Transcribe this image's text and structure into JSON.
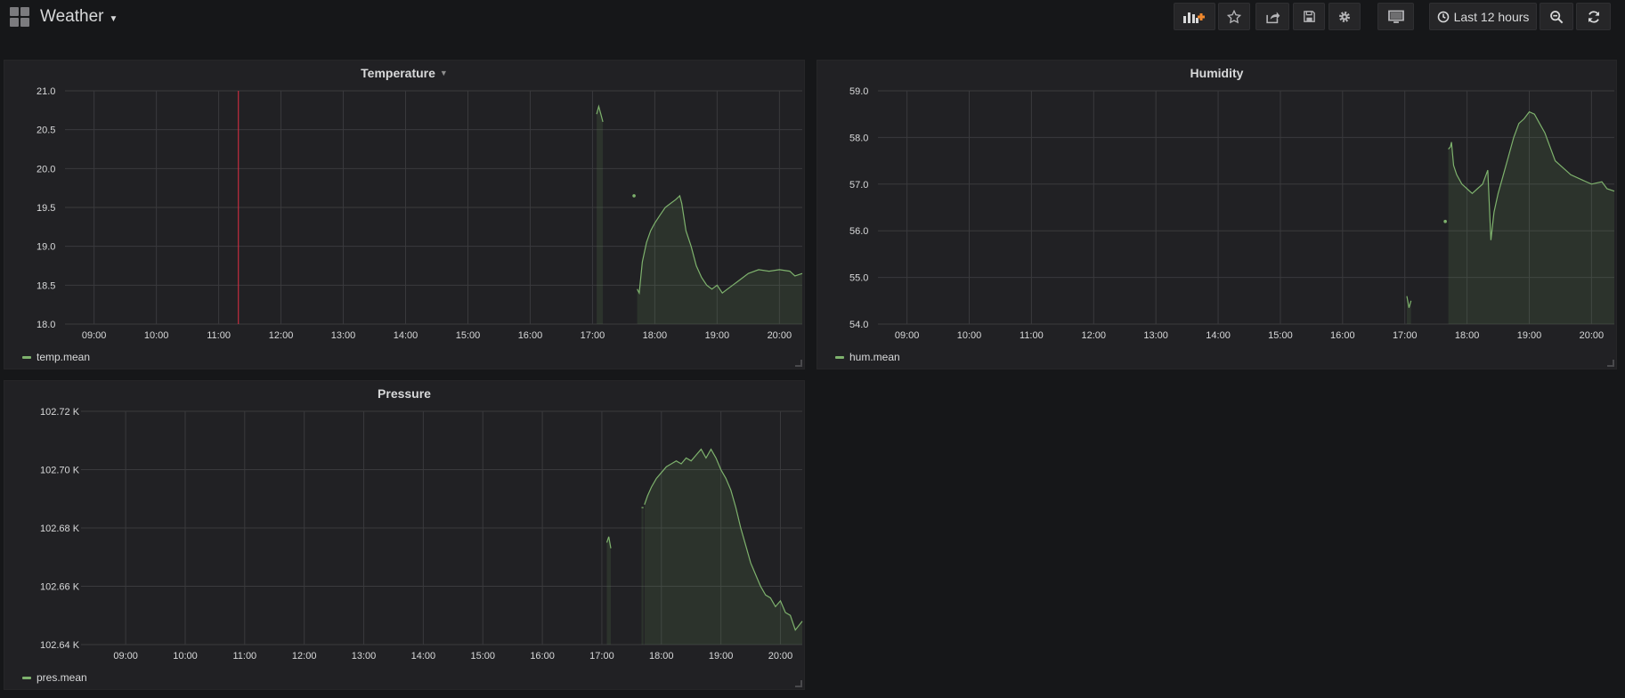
{
  "header": {
    "dashboard_title": "Weather",
    "time_range_label": "Last 12 hours"
  },
  "icons": {
    "add_panel": "add-panel-icon",
    "star": "star-icon",
    "share": "share-icon",
    "save": "save-icon",
    "settings": "gear-icon",
    "tv_mode": "monitor-icon",
    "clock": "clock-icon",
    "zoom_out": "zoom-out-icon",
    "refresh": "refresh-icon"
  },
  "colors": {
    "series": "#7eb26d",
    "annotation": "#e02f44",
    "background": "#161719",
    "panel": "#212124",
    "grid": "#3a3a3d"
  },
  "panels": [
    {
      "title": "Temperature",
      "legend": "temp.mean"
    },
    {
      "title": "Humidity",
      "legend": "hum.mean"
    },
    {
      "title": "Pressure",
      "legend": "pres.mean"
    }
  ],
  "chart_data": [
    {
      "type": "area",
      "title": "Temperature",
      "x_ticks": [
        "09:00",
        "10:00",
        "11:00",
        "12:00",
        "13:00",
        "14:00",
        "15:00",
        "16:00",
        "17:00",
        "18:00",
        "19:00",
        "20:00"
      ],
      "x_range": [
        "08:32",
        "20:22"
      ],
      "y_ticks": [
        "18.0",
        "18.5",
        "19.0",
        "19.5",
        "20.0",
        "20.5",
        "21.0"
      ],
      "ylim": [
        18.0,
        21.0
      ],
      "grid": true,
      "annotation_x": "11:19",
      "series": [
        {
          "name": "temp.mean",
          "segments": [
            [
              [
                "17:04",
                20.7
              ],
              [
                "17:06",
                20.8
              ],
              [
                "17:08",
                20.7
              ],
              [
                "17:10",
                20.6
              ]
            ],
            [
              [
                "17:40",
                19.65
              ]
            ],
            [
              [
                "17:43",
                18.45
              ],
              [
                "17:45",
                18.4
              ],
              [
                "17:48",
                18.8
              ],
              [
                "17:52",
                19.05
              ],
              [
                "17:56",
                19.2
              ],
              [
                "18:00",
                19.3
              ],
              [
                "18:05",
                19.4
              ],
              [
                "18:10",
                19.5
              ],
              [
                "18:15",
                19.55
              ],
              [
                "18:20",
                19.6
              ],
              [
                "18:24",
                19.65
              ],
              [
                "18:26",
                19.55
              ],
              [
                "18:30",
                19.2
              ],
              [
                "18:35",
                19.0
              ],
              [
                "18:40",
                18.75
              ],
              [
                "18:45",
                18.6
              ],
              [
                "18:50",
                18.5
              ],
              [
                "18:55",
                18.45
              ],
              [
                "19:00",
                18.5
              ],
              [
                "19:05",
                18.4
              ],
              [
                "19:10",
                18.45
              ],
              [
                "19:15",
                18.5
              ],
              [
                "19:20",
                18.55
              ],
              [
                "19:25",
                18.6
              ],
              [
                "19:30",
                18.65
              ],
              [
                "19:40",
                18.7
              ],
              [
                "19:50",
                18.68
              ],
              [
                "20:00",
                18.7
              ],
              [
                "20:10",
                18.68
              ],
              [
                "20:15",
                18.62
              ],
              [
                "20:22",
                18.65
              ]
            ]
          ]
        }
      ]
    },
    {
      "type": "area",
      "title": "Humidity",
      "x_ticks": [
        "09:00",
        "10:00",
        "11:00",
        "12:00",
        "13:00",
        "14:00",
        "15:00",
        "16:00",
        "17:00",
        "18:00",
        "19:00",
        "20:00"
      ],
      "x_range": [
        "08:32",
        "20:22"
      ],
      "y_ticks": [
        "54.0",
        "55.0",
        "56.0",
        "57.0",
        "58.0",
        "59.0"
      ],
      "ylim": [
        54.0,
        59.0
      ],
      "grid": true,
      "series": [
        {
          "name": "hum.mean",
          "segments": [
            [
              [
                "17:02",
                54.6
              ],
              [
                "17:04",
                54.35
              ],
              [
                "17:06",
                54.5
              ]
            ],
            [
              [
                "17:39",
                56.2
              ]
            ],
            [
              [
                "17:42",
                57.75
              ],
              [
                "17:44",
                57.8
              ],
              [
                "17:45",
                57.9
              ],
              [
                "17:47",
                57.4
              ],
              [
                "17:50",
                57.2
              ],
              [
                "17:55",
                57.0
              ],
              [
                "18:00",
                56.9
              ],
              [
                "18:05",
                56.8
              ],
              [
                "18:10",
                56.9
              ],
              [
                "18:15",
                57.0
              ],
              [
                "18:20",
                57.3
              ],
              [
                "18:23",
                55.8
              ],
              [
                "18:26",
                56.4
              ],
              [
                "18:30",
                56.8
              ],
              [
                "18:35",
                57.2
              ],
              [
                "18:40",
                57.6
              ],
              [
                "18:45",
                58.0
              ],
              [
                "18:50",
                58.3
              ],
              [
                "18:55",
                58.4
              ],
              [
                "19:00",
                58.55
              ],
              [
                "19:05",
                58.5
              ],
              [
                "19:10",
                58.3
              ],
              [
                "19:15",
                58.1
              ],
              [
                "19:20",
                57.8
              ],
              [
                "19:25",
                57.5
              ],
              [
                "19:30",
                57.4
              ],
              [
                "19:35",
                57.3
              ],
              [
                "19:40",
                57.2
              ],
              [
                "19:50",
                57.1
              ],
              [
                "20:00",
                57.0
              ],
              [
                "20:10",
                57.05
              ],
              [
                "20:15",
                56.9
              ],
              [
                "20:22",
                56.85
              ]
            ]
          ]
        }
      ]
    },
    {
      "type": "area",
      "title": "Pressure",
      "x_ticks": [
        "09:00",
        "10:00",
        "11:00",
        "12:00",
        "13:00",
        "14:00",
        "15:00",
        "16:00",
        "17:00",
        "18:00",
        "19:00",
        "20:00"
      ],
      "x_range": [
        "08:15",
        "20:22"
      ],
      "y_ticks": [
        "102.64 K",
        "102.66 K",
        "102.68 K",
        "102.70 K",
        "102.72 K"
      ],
      "ylim": [
        102.64,
        102.72
      ],
      "grid": true,
      "series": [
        {
          "name": "pres.mean",
          "segments": [
            [
              [
                "17:05",
                102.675
              ],
              [
                "17:07",
                102.677
              ],
              [
                "17:09",
                102.673
              ]
            ],
            [
              [
                "17:40",
                102.687
              ],
              [
                "17:42",
                102.687
              ]
            ],
            [
              [
                "17:43",
                102.688
              ],
              [
                "17:46",
                102.691
              ],
              [
                "17:50",
                102.694
              ],
              [
                "17:55",
                102.697
              ],
              [
                "18:00",
                102.699
              ],
              [
                "18:05",
                102.701
              ],
              [
                "18:10",
                102.702
              ],
              [
                "18:15",
                102.703
              ],
              [
                "18:20",
                102.702
              ],
              [
                "18:25",
                102.704
              ],
              [
                "18:30",
                102.703
              ],
              [
                "18:35",
                102.705
              ],
              [
                "18:40",
                102.707
              ],
              [
                "18:45",
                102.704
              ],
              [
                "18:50",
                102.707
              ],
              [
                "18:55",
                102.704
              ],
              [
                "19:00",
                102.7
              ],
              [
                "19:05",
                102.697
              ],
              [
                "19:10",
                102.693
              ],
              [
                "19:15",
                102.687
              ],
              [
                "19:20",
                102.68
              ],
              [
                "19:25",
                102.674
              ],
              [
                "19:30",
                102.668
              ],
              [
                "19:35",
                102.664
              ],
              [
                "19:40",
                102.66
              ],
              [
                "19:45",
                102.657
              ],
              [
                "19:50",
                102.656
              ],
              [
                "19:55",
                102.653
              ],
              [
                "20:00",
                102.655
              ],
              [
                "20:05",
                102.651
              ],
              [
                "20:10",
                102.65
              ],
              [
                "20:15",
                102.645
              ],
              [
                "20:22",
                102.648
              ]
            ]
          ]
        }
      ]
    }
  ]
}
